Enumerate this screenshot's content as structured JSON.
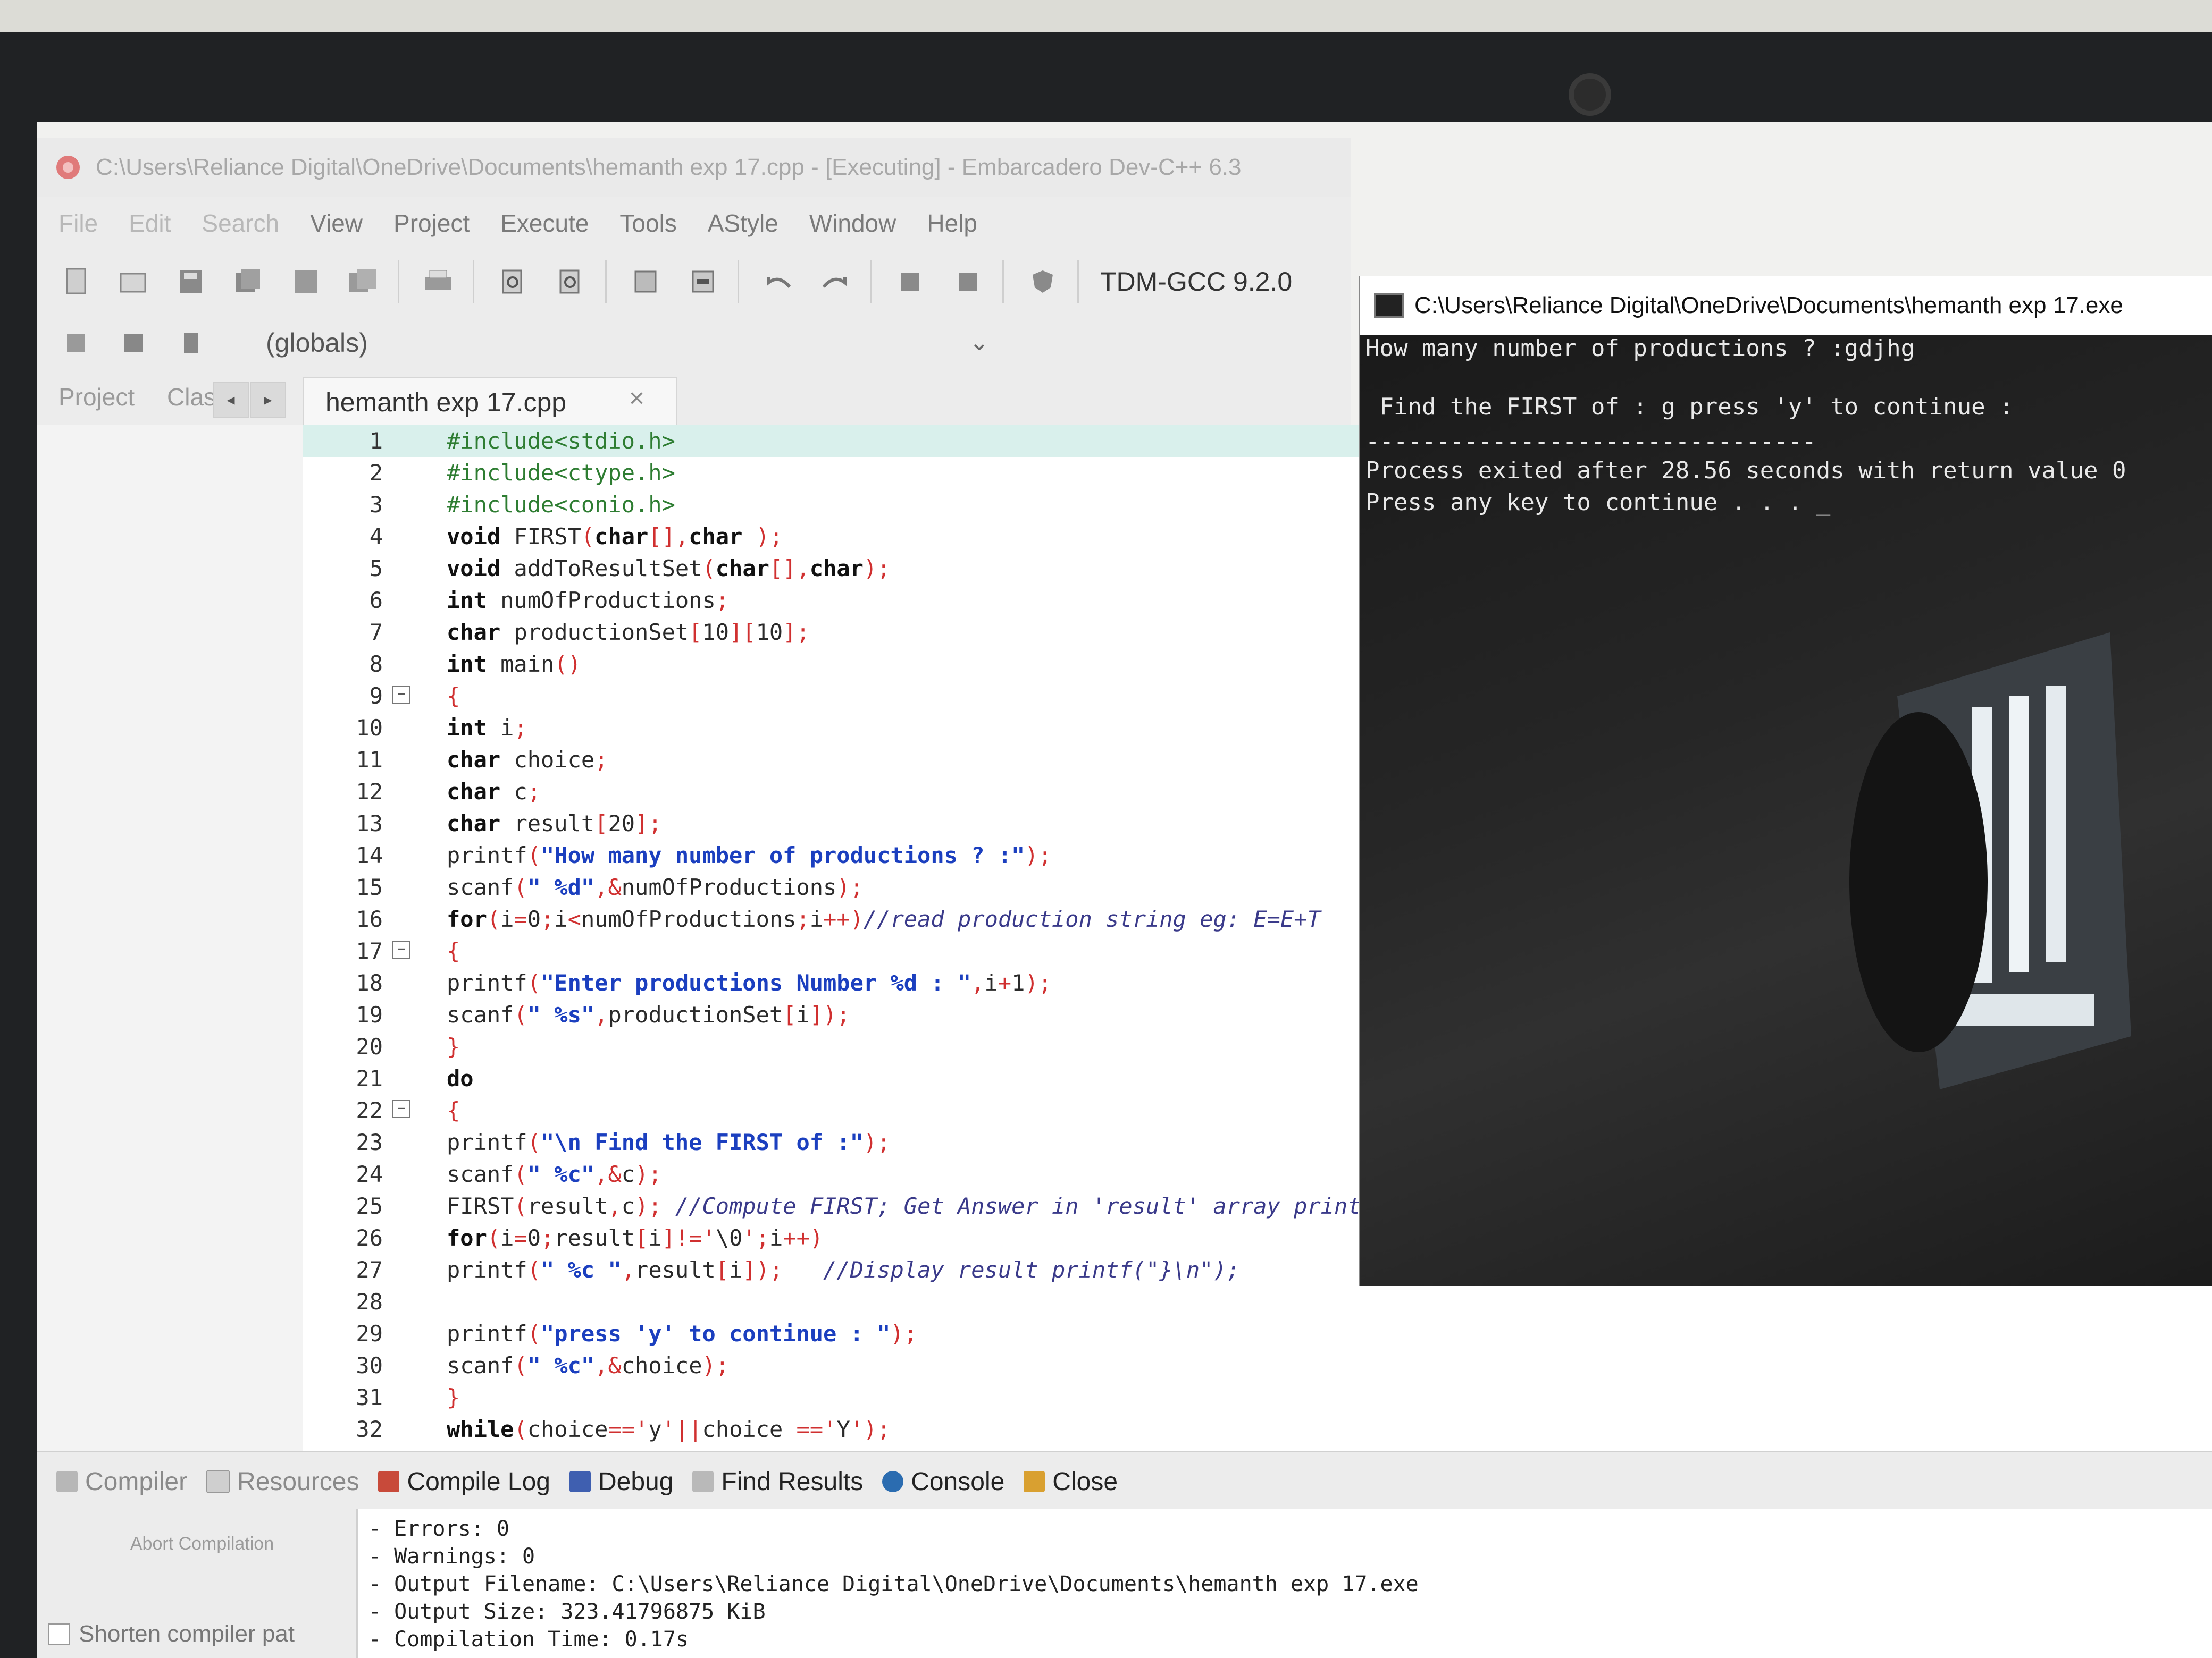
{
  "ide": {
    "window_title": "C:\\Users\\Reliance Digital\\OneDrive\\Documents\\hemanth exp 17.cpp - [Executing] - Embarcadero Dev-C++ 6.3",
    "menu": [
      "File",
      "Edit",
      "Search",
      "View",
      "Project",
      "Execute",
      "Tools",
      "AStyle",
      "Window",
      "Help"
    ],
    "compiler": "TDM-GCC 9.2.0",
    "scope_select": "(globals)",
    "left_tabs": [
      "Project",
      "Clas"
    ],
    "file_tab": "hemanth exp 17.cpp",
    "file_tab_close": "×"
  },
  "code_lines": [
    "#include<stdio.h>",
    "#include<ctype.h>",
    "#include<conio.h>",
    "void FIRST(char[],char );",
    "void addToResultSet(char[],char);",
    "int numOfProductions;",
    "char productionSet[10][10];",
    "int main()",
    "{",
    "int i;",
    "char choice;",
    "char c;",
    "char result[20];",
    "printf(\"How many number of productions ? :\");",
    "scanf(\" %d\",&numOfProductions);",
    "for(i=0;i<numOfProductions;i++)//read production string eg: E=E+T",
    "{",
    "printf(\"Enter productions Number %d : \",i+1);",
    "scanf(\" %s\",productionSet[i]);",
    "}",
    "do",
    "{",
    "printf(\"\\n Find the FIRST of :\");",
    "scanf(\" %c\",&c);",
    "FIRST(result,c); //Compute FIRST; Get Answer in 'result' array printf(\"\\n FIRST(%c)= { \",c);",
    "for(i=0;result[i]!='\\0';i++)",
    "printf(\" %c \",result[i]);   //Display result printf(\"}\\n\");",
    "",
    "printf(\"press 'y' to continue : \");",
    "scanf(\" %c\",&choice);",
    "}",
    "while(choice=='y'||choice =='Y');"
  ],
  "bottom_tabs": [
    "Compiler",
    "Resources",
    "Compile Log",
    "Debug",
    "Find Results",
    "Console",
    "Close"
  ],
  "compiler_panel": {
    "abort_label": "Abort Compilation",
    "shorten_label": "Shorten compiler pat",
    "output": [
      "- Errors: 0",
      "- Warnings: 0",
      "- Output Filename: C:\\Users\\Reliance Digital\\OneDrive\\Documents\\hemanth exp 17.exe",
      "- Output Size: 323.41796875 KiB",
      "- Compilation Time: 0.17s"
    ]
  },
  "console": {
    "title": "C:\\Users\\Reliance Digital\\OneDrive\\Documents\\hemanth exp 17.exe",
    "lines": [
      "How many number of productions ? :gdjhg",
      "",
      " Find the FIRST of : g press 'y' to continue :",
      "--------------------------------",
      "Process exited after 28.56 seconds with return value 0",
      "Press any key to continue . . . _"
    ]
  },
  "colors": {
    "highlight_line": "#d9f0ec",
    "string": "#1b3fbf",
    "symbol": "#d03030",
    "console_bg": "#0c0c0c"
  }
}
